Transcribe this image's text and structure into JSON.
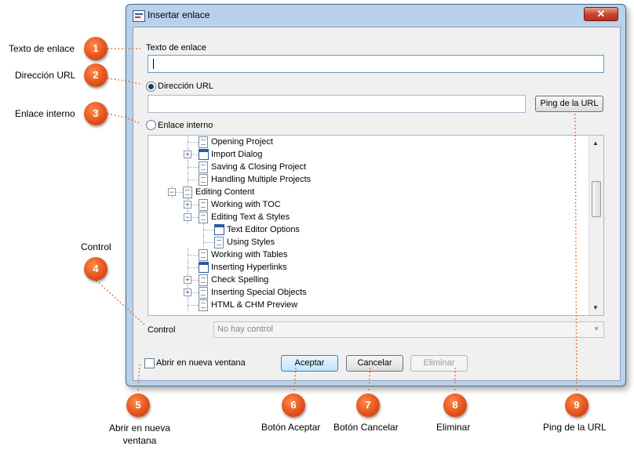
{
  "window": {
    "title": "Insertar enlace",
    "close_glyph": "✕"
  },
  "form": {
    "link_text_label": "Texto de enlace",
    "link_text_value": "",
    "url_radio_label": "Dirección URL",
    "url_radio_selected": true,
    "url_value": "",
    "ping_button": "Ping de la URL",
    "internal_radio_label": "Enlace interno",
    "internal_radio_selected": false,
    "control_label": "Control",
    "control_select_value": "No hay control",
    "open_new_window_label": "Abrir en nueva ventana",
    "open_new_window_checked": false,
    "accept_button": "Aceptar",
    "cancel_button": "Cancelar",
    "delete_button": "Eliminar"
  },
  "tree": {
    "items": [
      {
        "label": "Opening Project",
        "icon": "document-icon"
      },
      {
        "label": "Import Dialog",
        "icon": "window-icon",
        "expander": "+"
      },
      {
        "label": "Saving & Closing Project",
        "icon": "document-icon"
      },
      {
        "label": "Handling Multiple Projects",
        "icon": "document-icon"
      },
      {
        "label": "Editing Content",
        "icon": "document-icon",
        "expander": "−"
      },
      {
        "label": "Working with TOC",
        "icon": "document-icon",
        "expander": "+"
      },
      {
        "label": "Editing Text & Styles",
        "icon": "document-icon",
        "expander": "−"
      },
      {
        "label": "Text Editor Options",
        "icon": "window-icon"
      },
      {
        "label": "Using Styles",
        "icon": "document-icon"
      },
      {
        "label": "Working with Tables",
        "icon": "document-icon"
      },
      {
        "label": "Inserting Hyperlinks",
        "icon": "window-icon"
      },
      {
        "label": "Check Spelling",
        "icon": "document-icon",
        "expander": "+"
      },
      {
        "label": "Inserting Special Objects",
        "icon": "document-icon",
        "expander": "+"
      },
      {
        "label": "HTML & CHM Preview",
        "icon": "document-icon"
      }
    ],
    "scroll_up_glyph": "▲",
    "scroll_down_glyph": "▼"
  },
  "callouts": [
    {
      "number": "1",
      "text": "Texto de enlace"
    },
    {
      "number": "2",
      "text": "Dirección URL"
    },
    {
      "number": "3",
      "text": "Enlace interno"
    },
    {
      "number": "4",
      "text": "Control"
    },
    {
      "number": "5",
      "text": "Abrir en nueva ventana"
    },
    {
      "number": "6",
      "text": "Botón Aceptar"
    },
    {
      "number": "7",
      "text": "Botón Cancelar"
    },
    {
      "number": "8",
      "text": "Eliminar"
    },
    {
      "number": "9",
      "text": "Ping de la URL"
    }
  ],
  "colors": {
    "marker_orange": "#e0501a",
    "window_frame": "#b9d1ea",
    "leader_dots": "#e06020"
  }
}
